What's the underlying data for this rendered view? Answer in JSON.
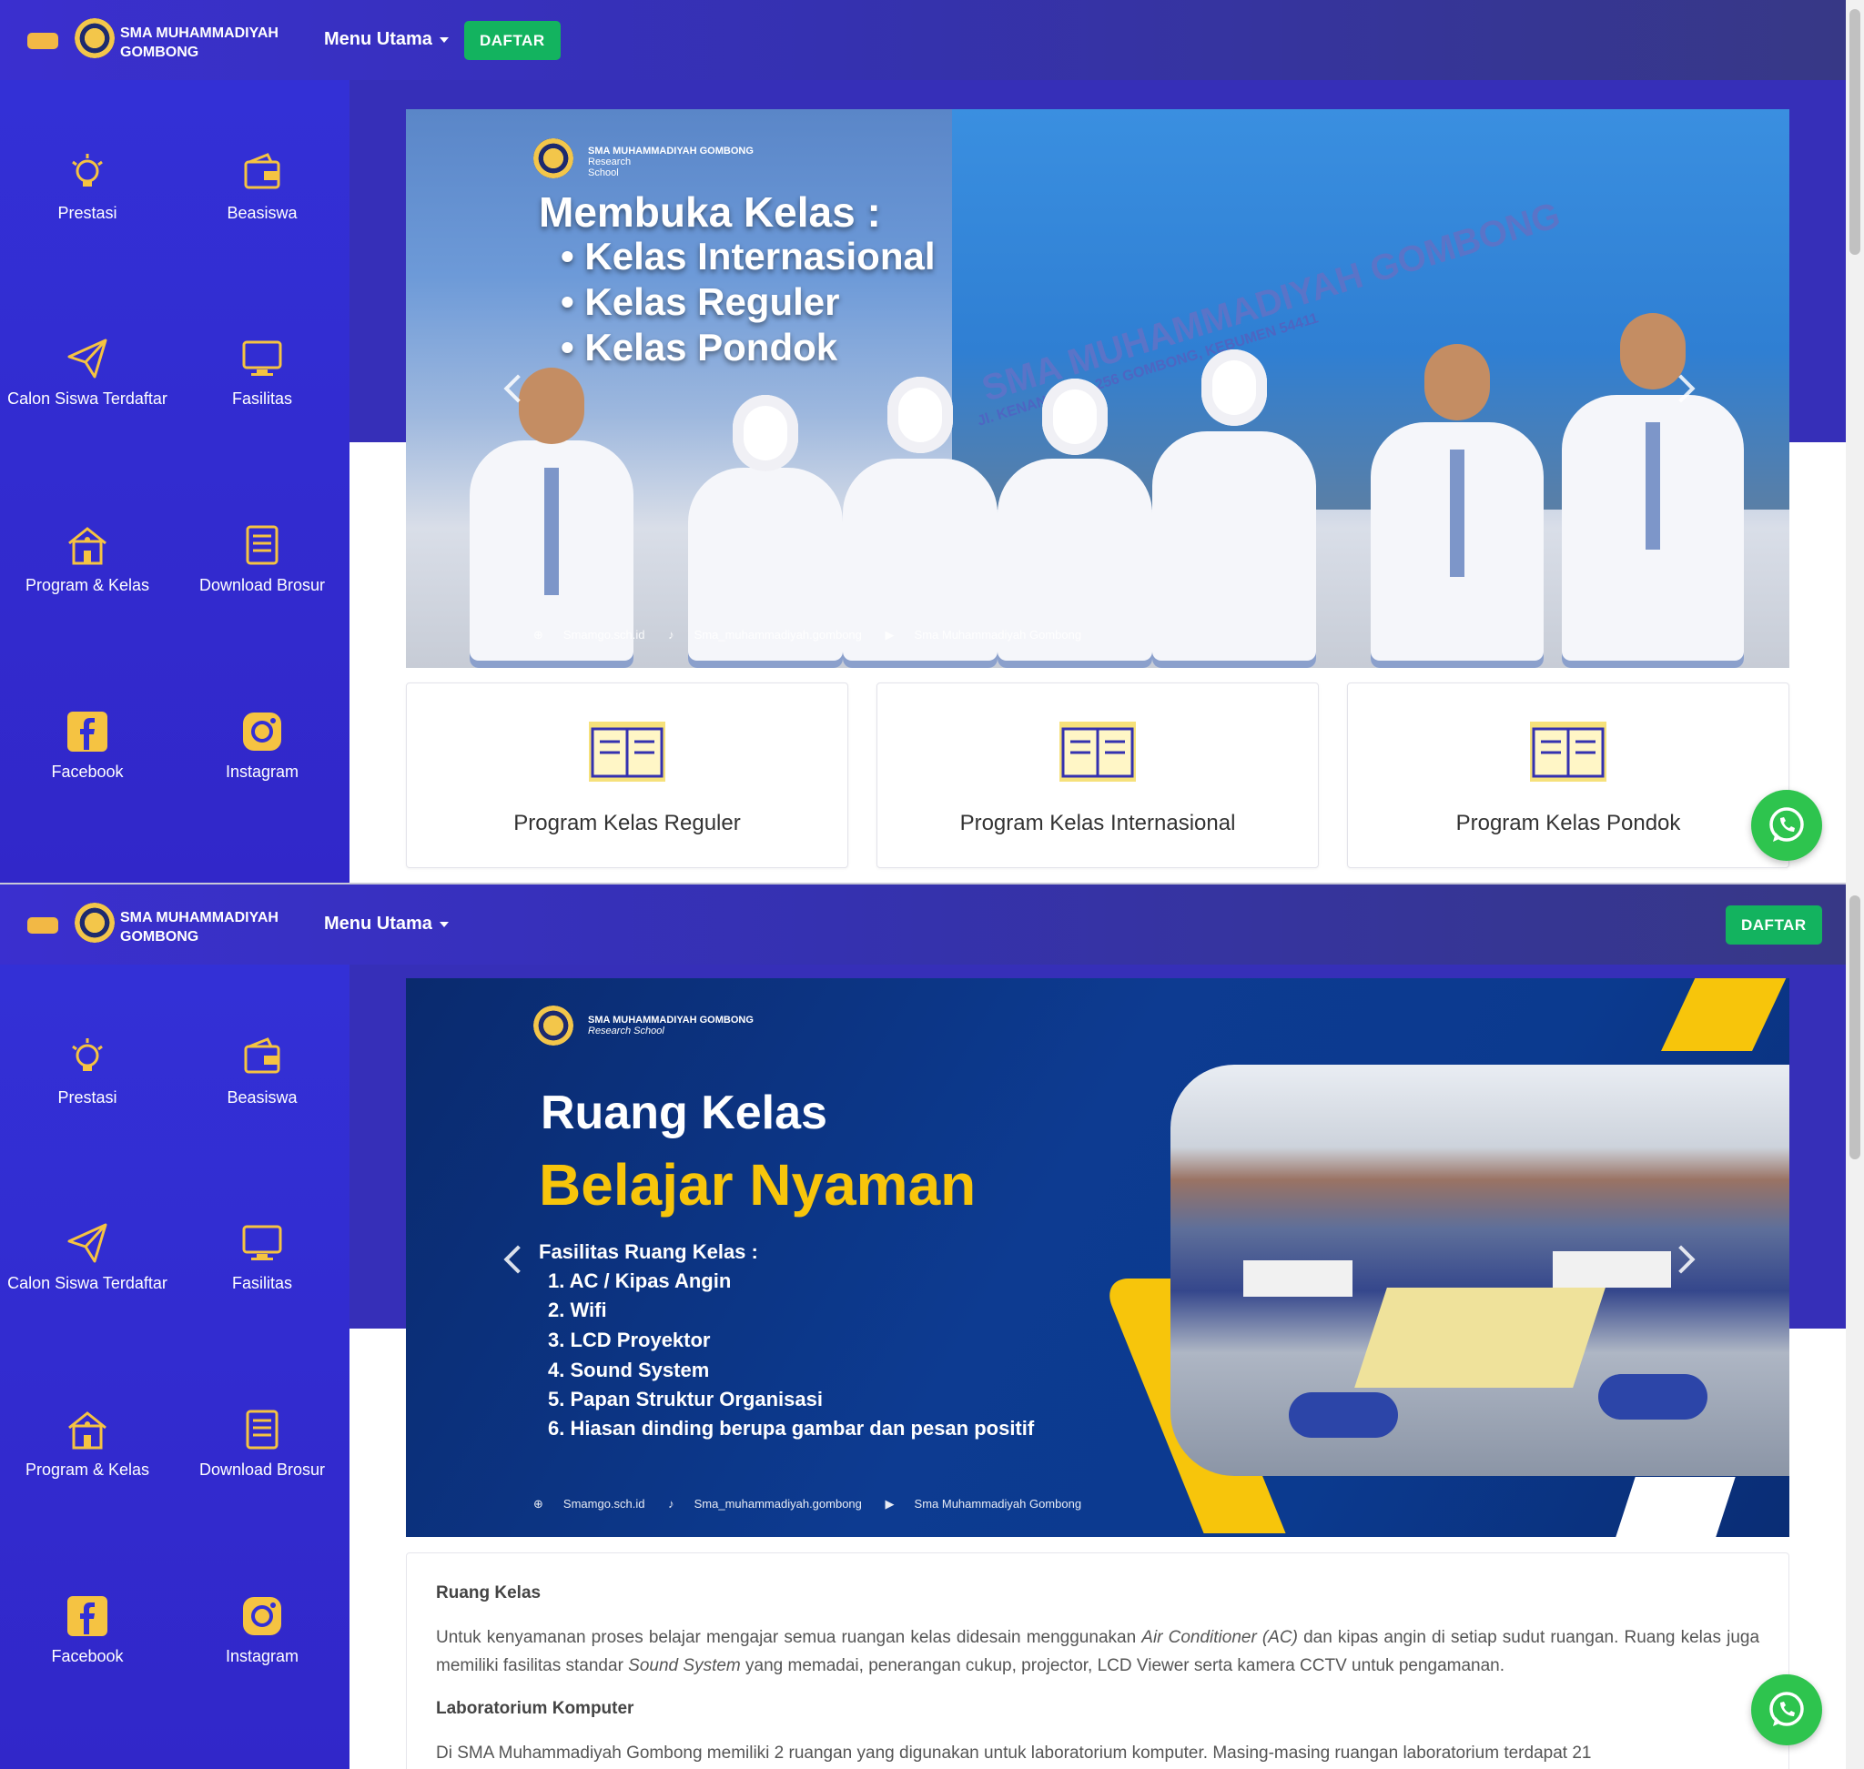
{
  "header": {
    "brand_line1": "SMA MUHAMMADIYAH",
    "brand_line2": "GOMBONG",
    "menu_label": "Menu Utama",
    "register_label": "DAFTAR"
  },
  "sidebar": {
    "items": [
      {
        "label": "Prestasi",
        "icon": "lightbulb-icon"
      },
      {
        "label": "Beasiswa",
        "icon": "wallet-icon"
      },
      {
        "label": "Calon Siswa Terdaftar",
        "icon": "paper-plane-icon"
      },
      {
        "label": "Fasilitas",
        "icon": "monitor-icon"
      },
      {
        "label": "Program & Kelas",
        "icon": "school-icon"
      },
      {
        "label": "Download Brosur",
        "icon": "document-icon"
      },
      {
        "label": "Facebook",
        "icon": "facebook-icon"
      },
      {
        "label": "Instagram",
        "icon": "instagram-icon"
      }
    ]
  },
  "slide1": {
    "brand": "SMA MUHAMMADIYAH GOMBONG",
    "brand_sub1": "Research",
    "brand_sub2": "School",
    "headline": "Membuka Kelas :",
    "bullets": [
      "Kelas Internasional",
      "Kelas Reguler",
      "Kelas Pondok"
    ],
    "building_sign": "SMA MUHAMMADIYAH GOMBONG",
    "building_address": "Jl. KENANGA NO.256 GOMBONG, KEBUMEN 54411",
    "footer_web": "Smamgo.sch.id",
    "footer_ig": "Sma_muhammadiyah.gombong",
    "footer_fb": "Sma Muhammadiyah Gombong"
  },
  "programs": [
    {
      "label": "Program Kelas Reguler"
    },
    {
      "label": "Program Kelas Internasional"
    },
    {
      "label": "Program Kelas Pondok"
    }
  ],
  "slide2": {
    "brand": "SMA MUHAMMADIYAH GOMBONG",
    "brand_sub": "Research School",
    "title1": "Ruang Kelas",
    "title2": "Belajar Nyaman",
    "list_title": "Fasilitas Ruang Kelas :",
    "items": [
      "1. AC / Kipas Angin",
      "2. Wifi",
      "3. LCD Proyektor",
      "4. Sound System",
      "5. Papan Struktur Organisasi",
      "6. Hiasan dinding berupa gambar dan pesan positif"
    ],
    "footer_web": "Smamgo.sch.id",
    "footer_ig": "Sma_muhammadiyah.gombong",
    "footer_fb": "Sma Muhammadiyah Gombong"
  },
  "content": {
    "section1_title": "Ruang Kelas",
    "section1_text_a": "Untuk kenyamanan proses belajar mengajar semua ruangan kelas didesain menggunakan ",
    "section1_text_em1": "Air Conditioner (AC)",
    "section1_text_b": " dan kipas angin di setiap sudut ruangan. Ruang kelas juga memiliki fasilitas standar ",
    "section1_text_em2": "Sound System",
    "section1_text_c": " yang memadai, penerangan cukup, projector, LCD Viewer serta kamera CCTV untuk pengamanan.",
    "section2_title": "Laboratorium Komputer",
    "section2_text": "Di SMA Muhammadiyah Gombong memiliki 2 ruangan yang digunakan untuk laboratorium komputer. Masing-masing ruangan laboratorium terdapat 21"
  },
  "colors": {
    "primary": "#3330d6",
    "accent": "#f2b845",
    "register_button": "#13b35f",
    "whatsapp": "#2ec44e"
  }
}
